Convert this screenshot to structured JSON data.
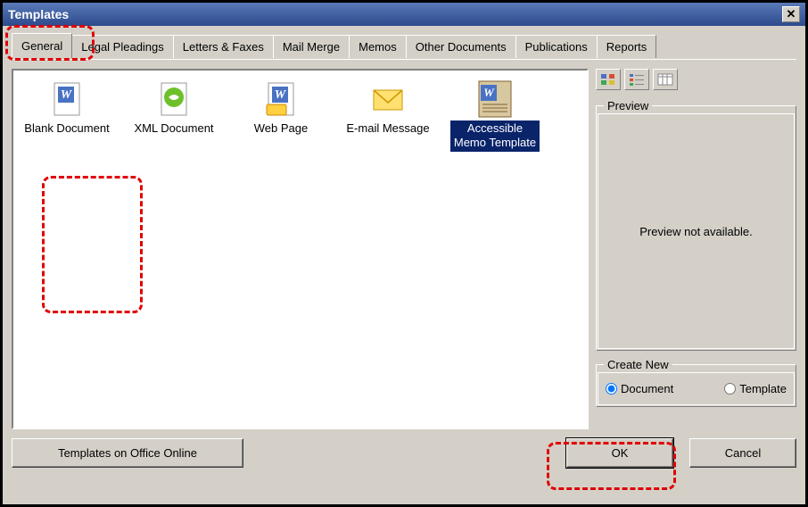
{
  "title": "Templates",
  "tabs": [
    {
      "label": "General"
    },
    {
      "label": "Legal Pleadings"
    },
    {
      "label": "Letters & Faxes"
    },
    {
      "label": "Mail Merge"
    },
    {
      "label": "Memos"
    },
    {
      "label": "Other Documents"
    },
    {
      "label": "Publications"
    },
    {
      "label": "Reports"
    }
  ],
  "templates": [
    {
      "label": "Blank Document"
    },
    {
      "label": "XML Document"
    },
    {
      "label": "Web Page"
    },
    {
      "label": "E-mail Message"
    },
    {
      "label": "Accessible Memo Template"
    }
  ],
  "preview_group": "Preview",
  "preview_text": "Preview not available.",
  "create_group": "Create New",
  "radio_document": "Document",
  "radio_template": "Template",
  "radio_selected": "document",
  "buttons": {
    "office_online": "Templates on Office Online",
    "ok": "OK",
    "cancel": "Cancel"
  }
}
